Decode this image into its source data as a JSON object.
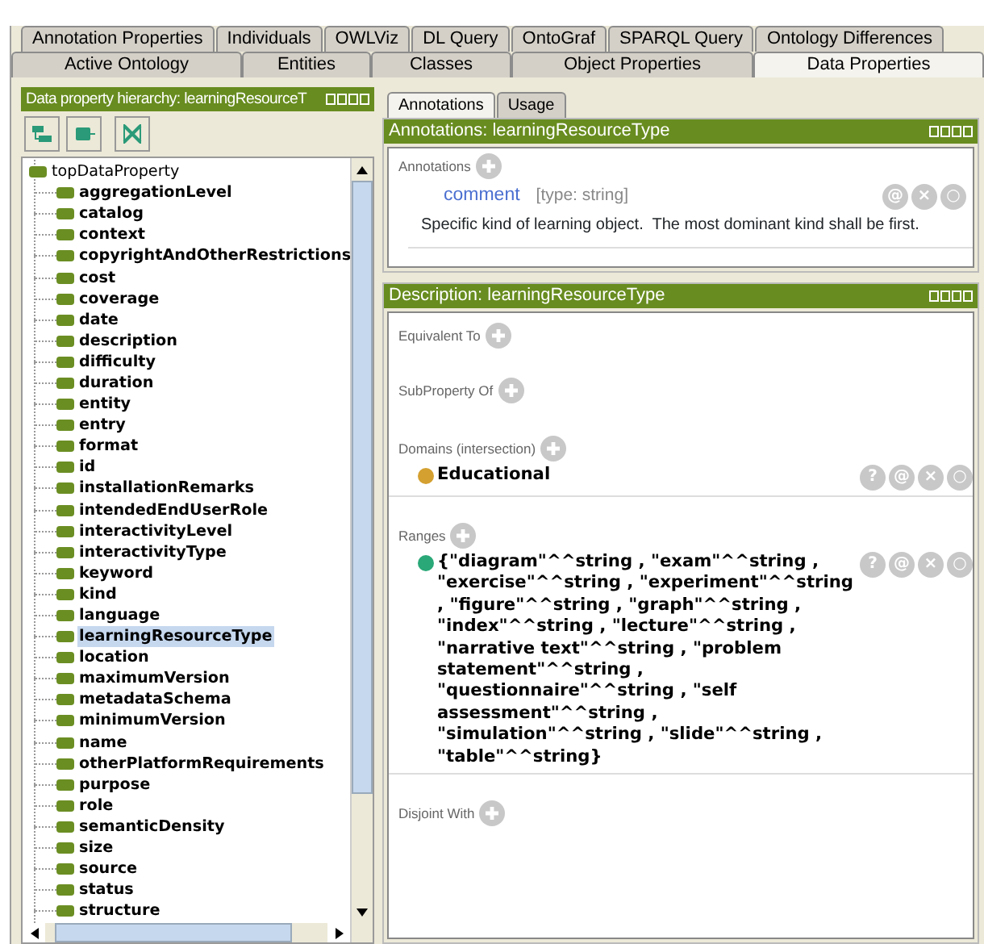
{
  "tabs_row_1": [
    {
      "label": "Annotation Properties",
      "selected": false
    },
    {
      "label": "Individuals",
      "selected": false
    },
    {
      "label": "OWLViz",
      "selected": false
    },
    {
      "label": "DL Query",
      "selected": false
    },
    {
      "label": "OntoGraf",
      "selected": false
    },
    {
      "label": "SPARQL Query",
      "selected": false
    },
    {
      "label": "Ontology Differences",
      "selected": false
    }
  ],
  "tabs_row_2": [
    {
      "label": "Active Ontology",
      "selected": false
    },
    {
      "label": "Entities",
      "selected": false
    },
    {
      "label": "Classes",
      "selected": false
    },
    {
      "label": "Object Properties",
      "selected": false
    },
    {
      "label": "Data Properties",
      "selected": true
    }
  ],
  "hierarchy": {
    "title": "Data property hierarchy: learningResourceT",
    "tree": [
      {
        "label": "topDataProperty",
        "selected": false,
        "children": [
          {
            "label": "aggregationLevel",
            "selected": false
          },
          {
            "label": "catalog",
            "selected": false
          },
          {
            "label": "context",
            "selected": false
          },
          {
            "label": "copyrightAndOtherRestrictions",
            "selected": false
          },
          {
            "label": "cost",
            "selected": false
          },
          {
            "label": "coverage",
            "selected": false
          },
          {
            "label": "date",
            "selected": false
          },
          {
            "label": "description",
            "selected": false
          },
          {
            "label": "difficulty",
            "selected": false
          },
          {
            "label": "duration",
            "selected": false
          },
          {
            "label": "entity",
            "selected": false
          },
          {
            "label": "entry",
            "selected": false
          },
          {
            "label": "format",
            "selected": false
          },
          {
            "label": "id",
            "selected": false
          },
          {
            "label": "installationRemarks",
            "selected": false
          },
          {
            "label": "intendedEndUserRole",
            "selected": false
          },
          {
            "label": "interactivityLevel",
            "selected": false
          },
          {
            "label": "interactivityType",
            "selected": false
          },
          {
            "label": "keyword",
            "selected": false
          },
          {
            "label": "kind",
            "selected": false
          },
          {
            "label": "language",
            "selected": false
          },
          {
            "label": "learningResourceType",
            "selected": true
          },
          {
            "label": "location",
            "selected": false
          },
          {
            "label": "maximumVersion",
            "selected": false
          },
          {
            "label": "metadataSchema",
            "selected": false
          },
          {
            "label": "minimumVersion",
            "selected": false
          },
          {
            "label": "name",
            "selected": false
          },
          {
            "label": "otherPlatformRequirements",
            "selected": false
          },
          {
            "label": "purpose",
            "selected": false
          },
          {
            "label": "role",
            "selected": false
          },
          {
            "label": "semanticDensity",
            "selected": false
          },
          {
            "label": "size",
            "selected": false
          },
          {
            "label": "source",
            "selected": false
          },
          {
            "label": "status",
            "selected": false
          },
          {
            "label": "structure",
            "selected": false
          }
        ]
      }
    ]
  },
  "inner_tabs": [
    {
      "label": "Annotations",
      "selected": true
    },
    {
      "label": "Usage",
      "selected": false
    }
  ],
  "annotations": {
    "title": "Annotations: learningResourceType",
    "section": "Annotations",
    "items": [
      {
        "property": "comment",
        "type": "[type: string]",
        "value": "Specific kind of learning object.  The most dominant kind shall be first.",
        "actions": [
          "@",
          "×",
          "○"
        ]
      }
    ]
  },
  "description": {
    "title": "Description: learningResourceType",
    "sections": [
      {
        "label": "Equivalent To"
      },
      {
        "label": "SubProperty Of"
      },
      {
        "label": "Domains (intersection)",
        "items": [
          {
            "text": "Educational",
            "color": "#d4a030",
            "actions": [
              "?",
              "@",
              "×",
              "○"
            ]
          }
        ]
      },
      {
        "label": "Ranges",
        "items": [
          {
            "text": "{\"diagram\"^^string , \"exam\"^^string , \"exercise\"^^string , \"experiment\"^^string , \"figure\"^^string , \"graph\"^^string , \"index\"^^string , \"lecture\"^^string , \"narrative text\"^^string , \"problem statement\"^^string , \"questionnaire\"^^string , \"self assessment\"^^string , \"simulation\"^^string , \"slide\"^^string , \"table\"^^string}",
            "color": "#2aa878",
            "actions": [
              "?",
              "@",
              "×",
              "○"
            ]
          }
        ]
      },
      {
        "label": "Disjoint With"
      }
    ]
  }
}
